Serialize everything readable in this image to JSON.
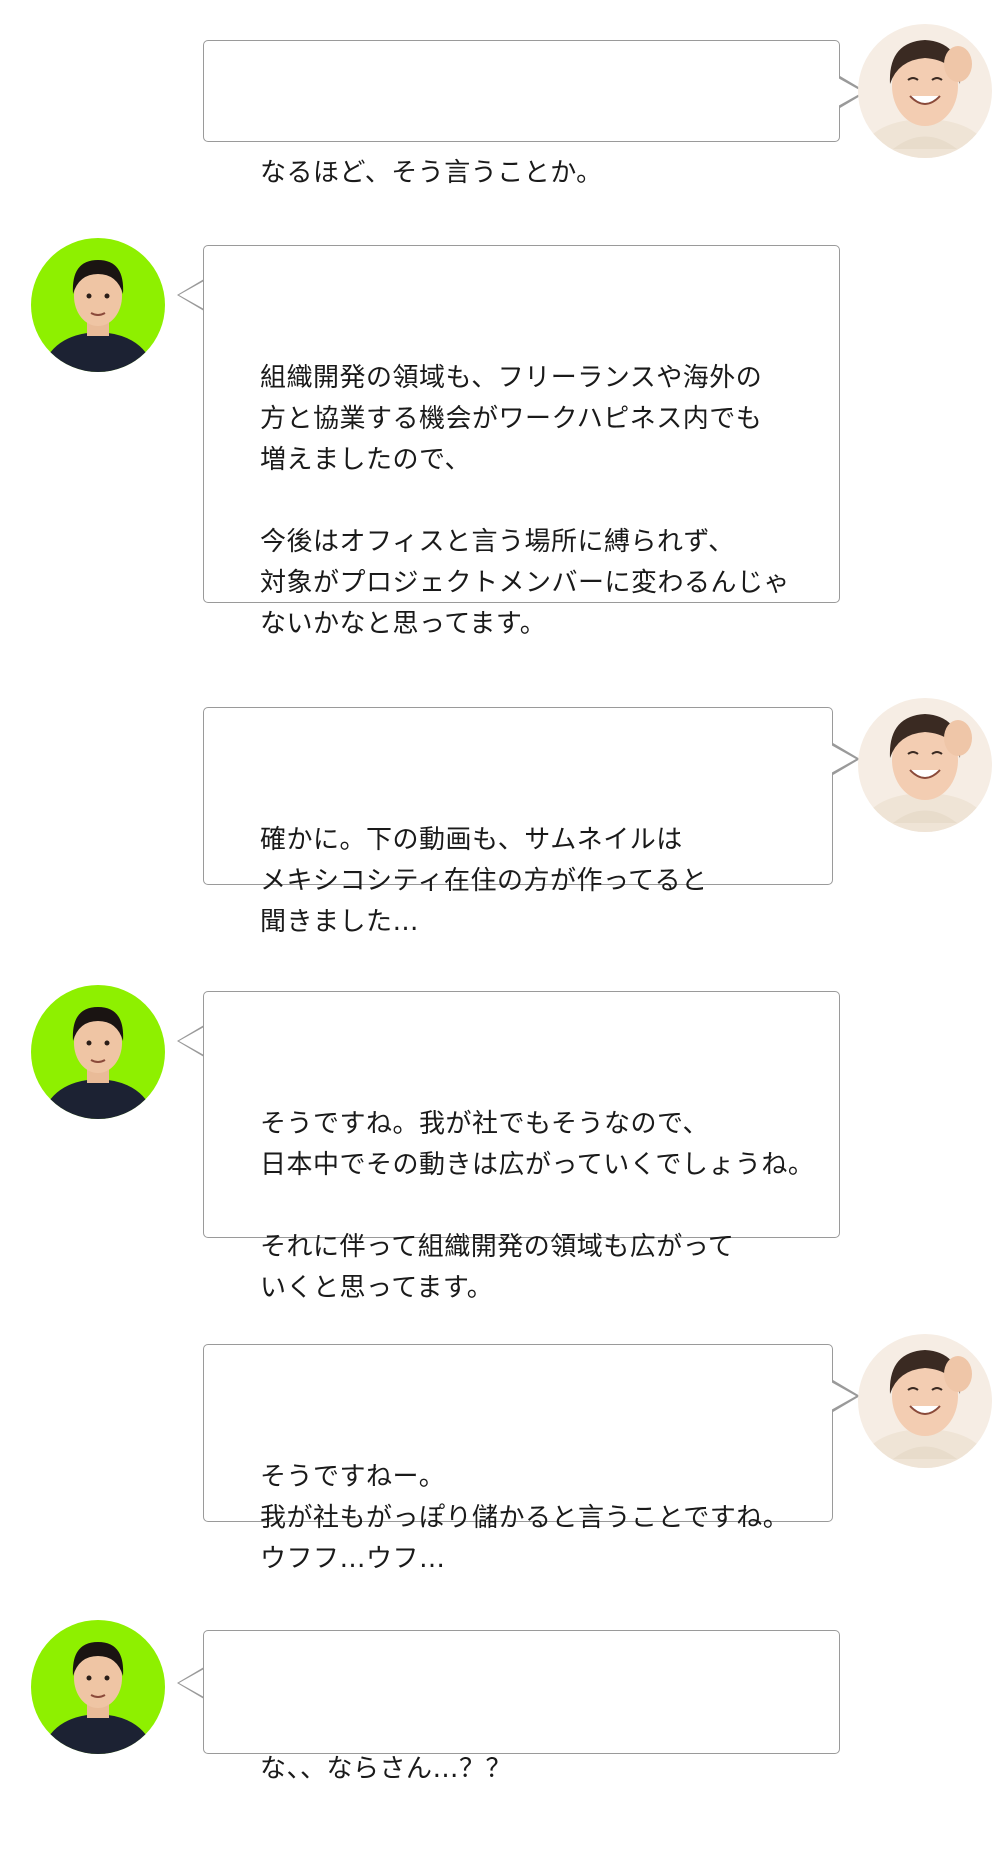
{
  "conversation": {
    "messages": [
      {
        "speaker": "woman",
        "side": "right",
        "text": "なるほど、そう言うことか。"
      },
      {
        "speaker": "man",
        "side": "left",
        "text": "組織開発の領域も、フリーランスや海外の\n方と協業する機会がワークハピネス内でも\n増えましたので、\n\n今後はオフィスと言う場所に縛られず、\n対象がプロジェクトメンバーに変わるんじゃ\nないかなと思ってます。"
      },
      {
        "speaker": "woman",
        "side": "right",
        "text": "確かに。下の動画も、サムネイルは\nメキシコシティ在住の方が作ってると\n聞きました…"
      },
      {
        "speaker": "man",
        "side": "left",
        "text": "そうですね。我が社でもそうなので、\n日本中でその動きは広がっていくでしょうね。\n\nそれに伴って組織開発の領域も広がって\nいくと思ってます。"
      },
      {
        "speaker": "woman",
        "side": "right",
        "text": "そうですねー。\n我が社もがっぽり儲かると言うことですね。\nウフフ…ウフ…"
      },
      {
        "speaker": "man",
        "side": "left",
        "text": "な、、ならさん…？？"
      }
    ]
  },
  "colors": {
    "bubble_border": "#9a9a9a",
    "man_avatar_bg": "#8ef000",
    "woman_avatar_bg": "#f6ede4"
  },
  "icons": {
    "man": "man-avatar-icon",
    "woman": "woman-avatar-icon"
  }
}
